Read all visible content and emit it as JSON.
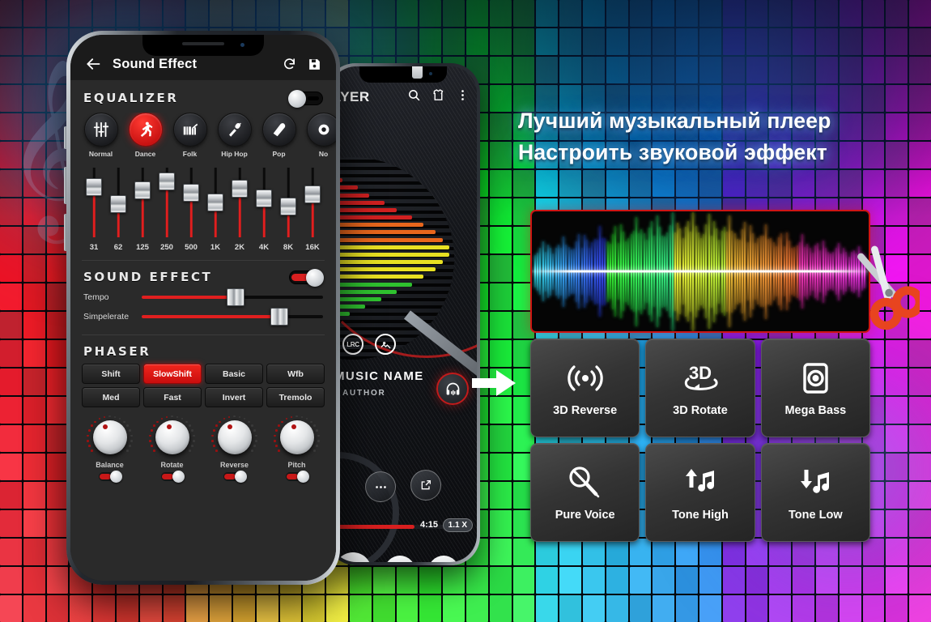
{
  "headline": {
    "line1": "Лучший музыкальный плеер",
    "line2": "Настроить звуковой эффект"
  },
  "phone_sound_effect": {
    "header": {
      "title": "Sound Effect",
      "back_icon": "back-arrow-icon",
      "reset_icon": "refresh-icon",
      "save_icon": "save-icon"
    },
    "equalizer": {
      "title": "EQUALIZER",
      "toggle_state": "off",
      "presets": [
        {
          "label": "Normal",
          "icon": "equalizer-sliders-icon",
          "active": false
        },
        {
          "label": "Dance",
          "icon": "dancer-icon",
          "active": true
        },
        {
          "label": "Folk",
          "icon": "accordion-icon",
          "active": false
        },
        {
          "label": "Hip Hop",
          "icon": "microphone-icon",
          "active": false
        },
        {
          "label": "Pop",
          "icon": "guitar-pick-icon",
          "active": false
        },
        {
          "label": "No",
          "icon": "partial-icon",
          "active": false
        }
      ],
      "bands": [
        {
          "label": "31",
          "value": 72
        },
        {
          "label": "62",
          "value": 48
        },
        {
          "label": "125",
          "value": 68
        },
        {
          "label": "250",
          "value": 80
        },
        {
          "label": "500",
          "value": 64
        },
        {
          "label": "1K",
          "value": 50
        },
        {
          "label": "2K",
          "value": 70
        },
        {
          "label": "4K",
          "value": 56
        },
        {
          "label": "8K",
          "value": 44
        },
        {
          "label": "16K",
          "value": 62
        }
      ]
    },
    "sound_effect": {
      "title": "SOUND EFFECT",
      "toggle_state": "on",
      "sliders": [
        {
          "label": "Tempo",
          "value": 52
        },
        {
          "label": "Simpelerate",
          "value": 76
        }
      ]
    },
    "phaser": {
      "title": "PHASER",
      "row1": [
        {
          "label": "Shift",
          "active": false
        },
        {
          "label": "SlowShift",
          "active": true
        },
        {
          "label": "Basic",
          "active": false
        },
        {
          "label": "Wfb",
          "active": false
        }
      ],
      "row2": [
        {
          "label": "Med",
          "active": false
        },
        {
          "label": "Fast",
          "active": false
        },
        {
          "label": "Invert",
          "active": false
        },
        {
          "label": "Tremolo",
          "active": false
        }
      ]
    },
    "knobs": [
      {
        "label": "Balance",
        "toggle_state": "on"
      },
      {
        "label": "Rotate",
        "toggle_state": "on"
      },
      {
        "label": "Reverse",
        "toggle_state": "on"
      },
      {
        "label": "Pitch",
        "toggle_state": "on"
      }
    ]
  },
  "phone_player": {
    "title": "AYER",
    "icons": [
      "search-icon",
      "theme-shirt-icon",
      "overflow-menu-icon"
    ],
    "lrc_badge": "LRC",
    "image_badge_icon": "image-icon",
    "track_name": "MUSIC NAME",
    "artist": "AUTHOR",
    "time": "4:15",
    "speed": "1.1 X",
    "equalizer_button_icon": "headphone-equalizer-icon",
    "controls": [
      {
        "icon": "play-icon"
      },
      {
        "icon": "next-track-icon"
      },
      {
        "icon": "playlist-icon"
      }
    ],
    "extra_buttons": [
      {
        "icon": "more-dots-icon"
      },
      {
        "icon": "share-icon"
      }
    ]
  },
  "effects_panel": {
    "waveform_label": "audio-waveform",
    "scissors_icon": "scissors-icon",
    "arrow_icon": "right-arrow-icon",
    "items": [
      {
        "label": "3D Reverse",
        "icon": "sound-waves-icon"
      },
      {
        "label": "3D Rotate",
        "icon": "3d-rotate-icon"
      },
      {
        "label": "Mega Bass",
        "icon": "speaker-square-icon"
      },
      {
        "label": "Pure Voice",
        "icon": "mic-off-icon"
      },
      {
        "label": "Tone High",
        "icon": "arrow-up-note-icon"
      },
      {
        "label": "Tone Low",
        "icon": "arrow-down-note-icon"
      }
    ]
  },
  "colors": {
    "accent_red": "#d81f1f",
    "panel_dark": "#2a2a2a",
    "border_red": "#cf1414"
  }
}
